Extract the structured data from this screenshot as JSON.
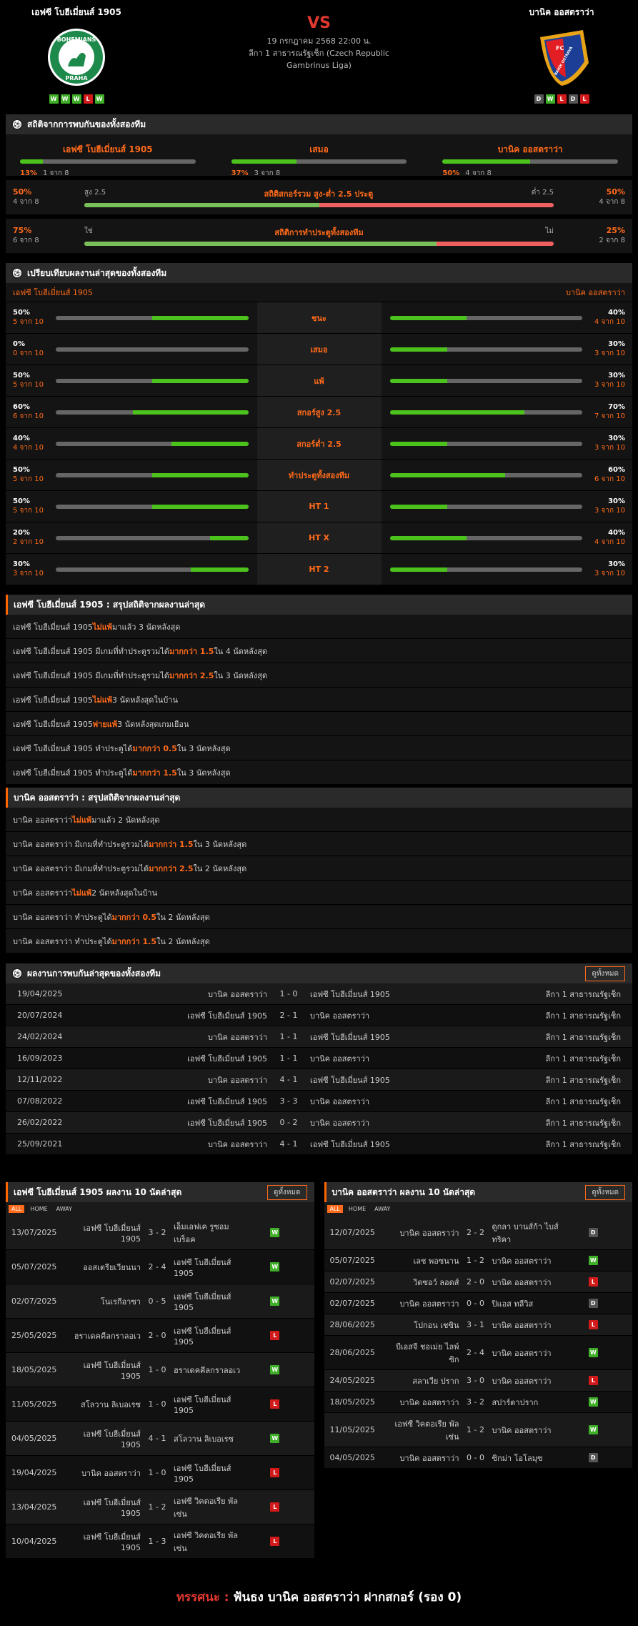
{
  "header": {
    "home": "เอฟซี โบฮีเมี่ยนส์ 1905",
    "away": "บานิค ออสตราว่า",
    "vs": "VS",
    "datetime": "19 กรกฎาคม 2568 22:00 น.",
    "league": "ลีกา 1 สาธารณรัฐเช็ก (Czech Republic Gambrinus Liga)",
    "home_form": [
      "W",
      "W",
      "W",
      "L",
      "W"
    ],
    "away_form": [
      "D",
      "W",
      "L",
      "D",
      "L"
    ],
    "home_logo_text": "BOHEMIANS",
    "home_logo_sub": "PRAHA",
    "away_logo_text": "BANÍK OSTRAVA",
    "away_logo_fc": "FC"
  },
  "h2h": {
    "title": "สถิติจากการพบกันของทั้งสองทีม",
    "cols": [
      {
        "label": "เอฟซี โบฮีเมี่ยนส์ 1905",
        "pct": "13%",
        "sub": "1 จาก 8",
        "v": 13
      },
      {
        "label": "เสมอ",
        "pct": "37%",
        "sub": "3 จาก 8",
        "v": 37
      },
      {
        "label": "บานิค ออสตราว่า",
        "pct": "50%",
        "sub": "4 จาก 8",
        "v": 50
      }
    ],
    "ou": {
      "lpct": "50%",
      "lsub": "4 จาก 8",
      "ltag": "สูง 2.5",
      "title": "สถิติสกอร์รวม สูง-ต่ำ 2.5 ประตู",
      "rtag": "ต่ำ 2.5",
      "rpct": "50%",
      "rsub": "4 จาก 8",
      "v": 50
    },
    "bt": {
      "lpct": "75%",
      "lsub": "6 จาก 8",
      "ltag": "ใช่",
      "title": "สถิติการทำประตูทั้งสองทีม",
      "rtag": "ไม่",
      "rpct": "25%",
      "rsub": "2 จาก 8",
      "v": 75
    }
  },
  "compare": {
    "title": "เปรียบเทียบผลงานล่าสุดของทั้งสองทีม",
    "home": "เอฟซี โบฮีเมี่ยนส์ 1905",
    "away": "บานิค ออสตราว่า",
    "rows": [
      {
        "label": "ชนะ",
        "lp": "50%",
        "ls": "5 จาก 10",
        "lv": 50,
        "rp": "40%",
        "rs": "4 จาก 10",
        "rv": 40
      },
      {
        "label": "เสมอ",
        "lp": "0%",
        "ls": "0 จาก 10",
        "lv": 0,
        "rp": "30%",
        "rs": "3 จาก 10",
        "rv": 30
      },
      {
        "label": "แพ้",
        "lp": "50%",
        "ls": "5 จาก 10",
        "lv": 50,
        "rp": "30%",
        "rs": "3 จาก 10",
        "rv": 30
      },
      {
        "label": "สกอร์สูง 2.5",
        "lp": "60%",
        "ls": "6 จาก 10",
        "lv": 60,
        "rp": "70%",
        "rs": "7 จาก 10",
        "rv": 70
      },
      {
        "label": "สกอร์ต่ำ 2.5",
        "lp": "40%",
        "ls": "4 จาก 10",
        "lv": 40,
        "rp": "30%",
        "rs": "3 จาก 10",
        "rv": 30
      },
      {
        "label": "ทำประตูทั้งสองทีม",
        "lp": "50%",
        "ls": "5 จาก 10",
        "lv": 50,
        "rp": "60%",
        "rs": "6 จาก 10",
        "rv": 60
      },
      {
        "label": "HT 1",
        "lp": "50%",
        "ls": "5 จาก 10",
        "lv": 50,
        "rp": "30%",
        "rs": "3 จาก 10",
        "rv": 30
      },
      {
        "label": "HT X",
        "lp": "20%",
        "ls": "2 จาก 10",
        "lv": 20,
        "rp": "40%",
        "rs": "4 จาก 10",
        "rv": 40
      },
      {
        "label": "HT 2",
        "lp": "30%",
        "ls": "3 จาก 10",
        "lv": 30,
        "rp": "30%",
        "rs": "3 จาก 10",
        "rv": 30
      }
    ]
  },
  "home_summary": {
    "title": "เอฟซี โบฮีเมี่ยนส์ 1905 : สรุปสถิติจากผลงานล่าสุด",
    "rows": [
      [
        "เอฟซี โบฮีเมี่ยนส์ 1905 ",
        "ไม่แพ้",
        " มาแล้ว 3 นัดหลังสุด"
      ],
      [
        "เอฟซี โบฮีเมี่ยนส์ 1905 มีเกมที่ทำประตูรวมได้ ",
        "มากกว่า 1.5",
        " ใน 4 นัดหลังสุด"
      ],
      [
        "เอฟซี โบฮีเมี่ยนส์ 1905 มีเกมที่ทำประตูรวมได้ ",
        "มากกว่า 2.5",
        " ใน 3 นัดหลังสุด"
      ],
      [
        "เอฟซี โบฮีเมี่ยนส์ 1905 ",
        "ไม่แพ้",
        " 3 นัดหลังสุดในบ้าน"
      ],
      [
        "เอฟซี โบฮีเมี่ยนส์ 1905 ",
        "พ่ายแพ้",
        " 3 นัดหลังสุดเกมเยือน"
      ],
      [
        "เอฟซี โบฮีเมี่ยนส์ 1905 ทำประตูได้ ",
        "มากกว่า 0.5",
        " ใน 3 นัดหลังสุด"
      ],
      [
        "เอฟซี โบฮีเมี่ยนส์ 1905 ทำประตูได้ ",
        "มากกว่า 1.5",
        " ใน 3 นัดหลังสุด"
      ]
    ]
  },
  "away_summary": {
    "title": "บานิค ออสตราว่า : สรุปสถิติจากผลงานล่าสุด",
    "rows": [
      [
        "บานิค ออสตราว่า ",
        "ไม่แพ้",
        " มาแล้ว 2 นัดหลังสุด"
      ],
      [
        "บานิค ออสตราว่า มีเกมที่ทำประตูรวมได้ ",
        "มากกว่า 1.5",
        " ใน 3 นัดหลังสุด"
      ],
      [
        "บานิค ออสตราว่า มีเกมที่ทำประตูรวมได้ ",
        "มากกว่า 2.5",
        " ใน 2 นัดหลังสุด"
      ],
      [
        "บานิค ออสตราว่า ",
        "ไม่แพ้",
        " 2 นัดหลังสุดในบ้าน"
      ],
      [
        "บานิค ออสตราว่า ทำประตูได้ ",
        "มากกว่า 0.5",
        " ใน 2 นัดหลังสุด"
      ],
      [
        "บานิค ออสตราว่า ทำประตูได้ ",
        "มากกว่า 1.5",
        " ใน 2 นัดหลังสุด"
      ]
    ]
  },
  "h2h_results": {
    "title": "ผลงานการพบกันล่าสุดของทั้งสองทีม",
    "btn": "ดูทั้งหมด",
    "rows": [
      [
        "19/04/2025",
        "บานิค ออสตราว่า",
        "1 - 0",
        "เอฟซี โบฮีเมี่ยนส์ 1905",
        "ลีกา 1 สาธารณรัฐเช็ก"
      ],
      [
        "20/07/2024",
        "เอฟซี โบฮีเมี่ยนส์ 1905",
        "2 - 1",
        "บานิค ออสตราว่า",
        "ลีกา 1 สาธารณรัฐเช็ก"
      ],
      [
        "24/02/2024",
        "บานิค ออสตราว่า",
        "1 - 1",
        "เอฟซี โบฮีเมี่ยนส์ 1905",
        "ลีกา 1 สาธารณรัฐเช็ก"
      ],
      [
        "16/09/2023",
        "เอฟซี โบฮีเมี่ยนส์ 1905",
        "1 - 1",
        "บานิค ออสตราว่า",
        "ลีกา 1 สาธารณรัฐเช็ก"
      ],
      [
        "12/11/2022",
        "บานิค ออสตราว่า",
        "4 - 1",
        "เอฟซี โบฮีเมี่ยนส์ 1905",
        "ลีกา 1 สาธารณรัฐเช็ก"
      ],
      [
        "07/08/2022",
        "เอฟซี โบฮีเมี่ยนส์ 1905",
        "3 - 3",
        "บานิค ออสตราว่า",
        "ลีกา 1 สาธารณรัฐเช็ก"
      ],
      [
        "26/02/2022",
        "เอฟซี โบฮีเมี่ยนส์ 1905",
        "0 - 2",
        "บานิค ออสตราว่า",
        "ลีกา 1 สาธารณรัฐเช็ก"
      ],
      [
        "25/09/2021",
        "บานิค ออสตราว่า",
        "4 - 1",
        "เอฟซี โบฮีเมี่ยนส์ 1905",
        "ลีกา 1 สาธารณรัฐเช็ก"
      ]
    ]
  },
  "home_last": {
    "title": "เอฟซี โบฮีเมี่ยนส์ 1905 ผลงาน 10 นัดล่าสุด",
    "btn": "ดูทั้งหมด",
    "tabs": [
      "ALL",
      "HOME",
      "AWAY"
    ],
    "rows": [
      [
        "13/07/2025",
        "เอฟซี โบฮีเมี่ยนส์ 1905",
        "3 - 2",
        "เอ็มเอฟเค รูซอมเบร็อค",
        "W"
      ],
      [
        "05/07/2025",
        "ออสเตรียเวียนนา",
        "2 - 4",
        "เอฟซี โบฮีเมี่ยนส์ 1905",
        "W"
      ],
      [
        "02/07/2025",
        "โนเรกีอาซา",
        "0 - 5",
        "เอฟซี โบฮีเมี่ยนส์ 1905",
        "W"
      ],
      [
        "25/05/2025",
        "ฮราเดคคีลกราลอเว",
        "2 - 0",
        "เอฟซี โบฮีเมี่ยนส์ 1905",
        "L"
      ],
      [
        "18/05/2025",
        "เอฟซี โบฮีเมี่ยนส์ 1905",
        "1 - 0",
        "ฮราเดคคีลกราลอเว",
        "W"
      ],
      [
        "11/05/2025",
        "สโลวาน ลิเบอเรซ",
        "1 - 0",
        "เอฟซี โบฮีเมี่ยนส์ 1905",
        "L"
      ],
      [
        "04/05/2025",
        "เอฟซี โบฮีเมี่ยนส์ 1905",
        "4 - 1",
        "สโลวาน ลิเบอเรซ",
        "W"
      ],
      [
        "19/04/2025",
        "บานิค ออสตราว่า",
        "1 - 0",
        "เอฟซี โบฮีเมี่ยนส์ 1905",
        "L"
      ],
      [
        "13/04/2025",
        "เอฟซี โบฮีเมี่ยนส์ 1905",
        "1 - 2",
        "เอฟซี วิคตอเรีย พัลเซ่น",
        "L"
      ],
      [
        "10/04/2025",
        "เอฟซี โบฮีเมี่ยนส์ 1905",
        "1 - 3",
        "เอฟซี วิคตอเรีย พัลเซ่น",
        "L"
      ]
    ]
  },
  "away_last": {
    "title": "บานิค ออสตราว่า ผลงาน 10 นัดล่าสุด",
    "btn": "ดูทั้งหมด",
    "tabs": [
      "ALL",
      "HOME",
      "AWAY"
    ],
    "rows": [
      [
        "12/07/2025",
        "บานิค ออสตราว่า",
        "2 - 2",
        "ดูกลา บานส์ก้า ไบส์ทริคา",
        "D"
      ],
      [
        "05/07/2025",
        "เลช พอซนาน",
        "1 - 2",
        "บานิค ออสตราว่า",
        "W"
      ],
      [
        "02/07/2025",
        "วิดซอว์ ลอดส์",
        "2 - 0",
        "บานิค ออสตราว่า",
        "L"
      ],
      [
        "02/07/2025",
        "บานิค ออสตราว่า",
        "0 - 0",
        "ปิแอส ทลีวิส",
        "D"
      ],
      [
        "28/06/2025",
        "โปกอน เชซิน",
        "3 - 1",
        "บานิค ออสตราว่า",
        "L"
      ],
      [
        "28/06/2025",
        "บีเอสจี ชอเม่ย ไลพ์ซิก",
        "2 - 4",
        "บานิค ออสตราว่า",
        "W"
      ],
      [
        "24/05/2025",
        "สลาเวีย ปราก",
        "3 - 0",
        "บานิค ออสตราว่า",
        "L"
      ],
      [
        "18/05/2025",
        "บานิค ออสตราว่า",
        "3 - 2",
        "สปาร์ตาปราก",
        "W"
      ],
      [
        "11/05/2025",
        "เอฟซี วิคตอเรีย พัลเซ่น",
        "1 - 2",
        "บานิค ออสตราว่า",
        "W"
      ],
      [
        "04/05/2025",
        "บานิค ออสตราว่า",
        "0 - 0",
        "ซิกม่า โอโลมุซ",
        "D"
      ]
    ]
  },
  "verdict": {
    "label": "ทรรศนะ :",
    "text": " ฟันธง บานิค ออสตราว่า ฝากสกอร์ (รอง 0)"
  }
}
